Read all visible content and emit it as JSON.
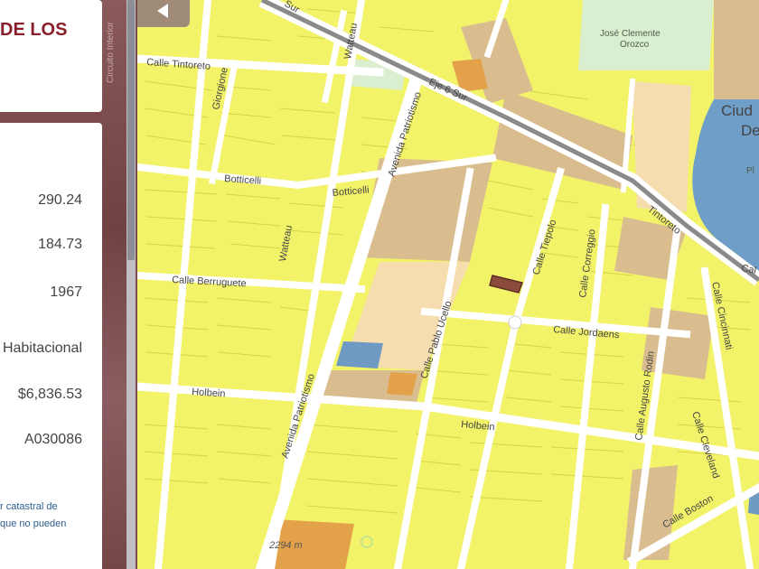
{
  "panel": {
    "title": "DE LOS",
    "road_label": "Circuito Interior",
    "values": [
      "290.24",
      "184.73",
      "1967",
      "Habitacional",
      "$6,836.53",
      "A030086"
    ],
    "note_lines": [
      "r catastral de",
      "que no pueden"
    ]
  },
  "map": {
    "streets": {
      "tintoreto_top": "Calle Tintoreto",
      "eje6": "Eje 6 Sur",
      "tintoreto_diag": "Tintoreto",
      "calle_right_edge": "Cal",
      "botticelli_1": "Botticelli",
      "botticelli_2": "Botticelli",
      "berruguete": "Calle Berruguete",
      "holbein_left": "Holbein",
      "holbein_mid": "Holbein",
      "jordaens": "Calle Jordaens",
      "giorgione": "Giorgione",
      "watteau_top": "Watteau",
      "watteau_mid": "Watteau",
      "av_patriotismo_top": "Avenida Patriotismo",
      "av_patriotismo_bottom": "Avenida Patriotismo",
      "pablo_ucello": "Calle Pablo Ucello",
      "tiepolo": "Calle Tiepolo",
      "correggio": "Calle Correggio",
      "augusto_rodin": "Calle Augusto Rodin",
      "cincinnati": "Calle Cincinnati",
      "cleveland": "Calle Cleveland",
      "boston": "Calle Boston",
      "sur_top": "Sur"
    },
    "poi": {
      "park_line1": "José Clemente",
      "park_line2": "Orozco",
      "ciudad_line1": "Ciud",
      "ciudad_line2": "De",
      "plaza": "Pl",
      "elevation": "2294 m"
    },
    "colors": {
      "lot_yellow": "#f3f36a",
      "lot_border": "#d6d64a",
      "street": "#ffffff",
      "blue_lot": "#6e9ac4",
      "orange_lot": "#e3a24a",
      "tan_lot": "#d9bd8f",
      "selected_lot": "#8a4a3c",
      "park": "#d9efcf",
      "water": "#6f9fc8"
    }
  }
}
